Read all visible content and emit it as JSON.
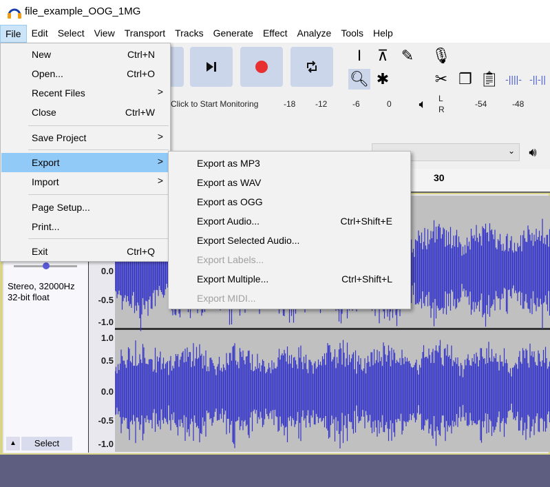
{
  "window": {
    "title": "file_example_OOG_1MG"
  },
  "menubar": [
    "File",
    "Edit",
    "Select",
    "View",
    "Transport",
    "Tracks",
    "Generate",
    "Effect",
    "Analyze",
    "Tools",
    "Help"
  ],
  "file_menu": [
    {
      "label": "New",
      "shortcut": "Ctrl+N"
    },
    {
      "label": "Open...",
      "shortcut": "Ctrl+O"
    },
    {
      "label": "Recent Files",
      "submenu": true
    },
    {
      "label": "Close",
      "shortcut": "Ctrl+W"
    },
    {
      "label": "Save Project",
      "submenu": true
    },
    {
      "label": "Export",
      "submenu": true,
      "highlighted": true
    },
    {
      "label": "Import",
      "submenu": true
    },
    {
      "label": "Page Setup..."
    },
    {
      "label": "Print..."
    },
    {
      "label": "Exit",
      "shortcut": "Ctrl+Q"
    }
  ],
  "submenu_arrow": ">",
  "export_menu": [
    {
      "label": "Export as MP3",
      "shortcut": ""
    },
    {
      "label": "Export as WAV",
      "shortcut": ""
    },
    {
      "label": "Export as OGG",
      "shortcut": ""
    },
    {
      "label": "Export Audio...",
      "shortcut": "Ctrl+Shift+E"
    },
    {
      "label": "Export Selected Audio...",
      "shortcut": ""
    },
    {
      "label": "Export Labels...",
      "shortcut": "",
      "disabled": true
    },
    {
      "label": "Export Multiple...",
      "shortcut": "Ctrl+Shift+L"
    },
    {
      "label": "Export MIDI...",
      "shortcut": "",
      "disabled": true
    }
  ],
  "toolbar": {
    "monitor_text": "Click to Start Monitoring",
    "record_meter_ticks": [
      "-18",
      "-12",
      "-6",
      "0"
    ],
    "playback_meter_ticks": [
      "-54",
      "-48"
    ],
    "lr": {
      "l": "L",
      "r": "R"
    },
    "record_color": "#e83030"
  },
  "timeline": {
    "tick_label": "30"
  },
  "track": {
    "info": "Stereo, 32000Hz",
    "format": "32-bit float",
    "select_label": "Select",
    "collapse_glyph": "▲",
    "upper_scale": [
      "0.0",
      "-0.5",
      "-1.0"
    ],
    "lower_scale": [
      "1.0",
      "0.5",
      "0.0",
      "-0.5",
      "-1.0"
    ],
    "wave_color": "#3232c8"
  }
}
